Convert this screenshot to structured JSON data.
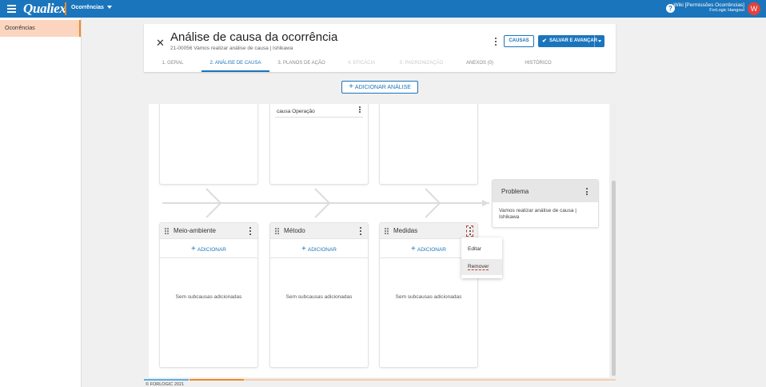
{
  "topbar": {
    "logo": "Qualiex",
    "module": "Ocorrências",
    "help": "?",
    "user_name": "Wiki [Permissões Ocorrências]",
    "user_org": "ForLogic Hangout",
    "avatar": "W"
  },
  "sidebar": {
    "items": [
      {
        "label": "Ocorrências",
        "active": true
      }
    ]
  },
  "header": {
    "title": "Análise de causa da ocorrência",
    "subtitle": "21-00056 Vamos realizar análise de causa | Ishikawa",
    "causas_label": "CAUSAS",
    "save_label": "SALVAR E AVANÇAR"
  },
  "tabs": [
    {
      "label": "1. GERAL",
      "state": "normal"
    },
    {
      "label": "2. ANÁLISE DE CAUSA",
      "state": "active"
    },
    {
      "label": "3. PLANOS DE AÇÃO",
      "state": "normal"
    },
    {
      "label": "4. EFICÁCIA",
      "state": "disabled"
    },
    {
      "label": "5. PADRONIZAÇÃO",
      "state": "disabled"
    },
    {
      "label": "ANEXOS (0)",
      "state": "normal"
    },
    {
      "label": "HISTÓRICO",
      "state": "normal"
    }
  ],
  "add_analysis_label": "ADICIONAR ANÁLISE",
  "top_boxes": [
    {
      "text": ""
    },
    {
      "text": "causa Operação"
    },
    {
      "text": ""
    }
  ],
  "categories": [
    {
      "name": "Meio-ambiente",
      "add_label": "ADICIONAR",
      "empty_text": "Sem subcausas adicionadas"
    },
    {
      "name": "Método",
      "add_label": "ADICIONAR",
      "empty_text": "Sem subcausas adicionadas"
    },
    {
      "name": "Medidas",
      "add_label": "ADICIONAR",
      "empty_text": "Sem subcausas adicionadas"
    }
  ],
  "problem": {
    "title": "Problema",
    "description": "Vamos realizar análise de causa | Ishikawa"
  },
  "context_menu": {
    "items": [
      {
        "label": "Editar"
      },
      {
        "label": "Remover"
      }
    ]
  },
  "footer": {
    "text": "© FORLOGIC 2021"
  },
  "colors": {
    "primary": "#1b75bc",
    "accent": "#f08a24",
    "sidebar_active": "#fcd5c0"
  },
  "icons": [
    "menu-icon",
    "help-icon",
    "close-icon",
    "check-icon",
    "plus-icon",
    "drag-handle-icon",
    "kebab-icon",
    "chevron-down-icon"
  ]
}
